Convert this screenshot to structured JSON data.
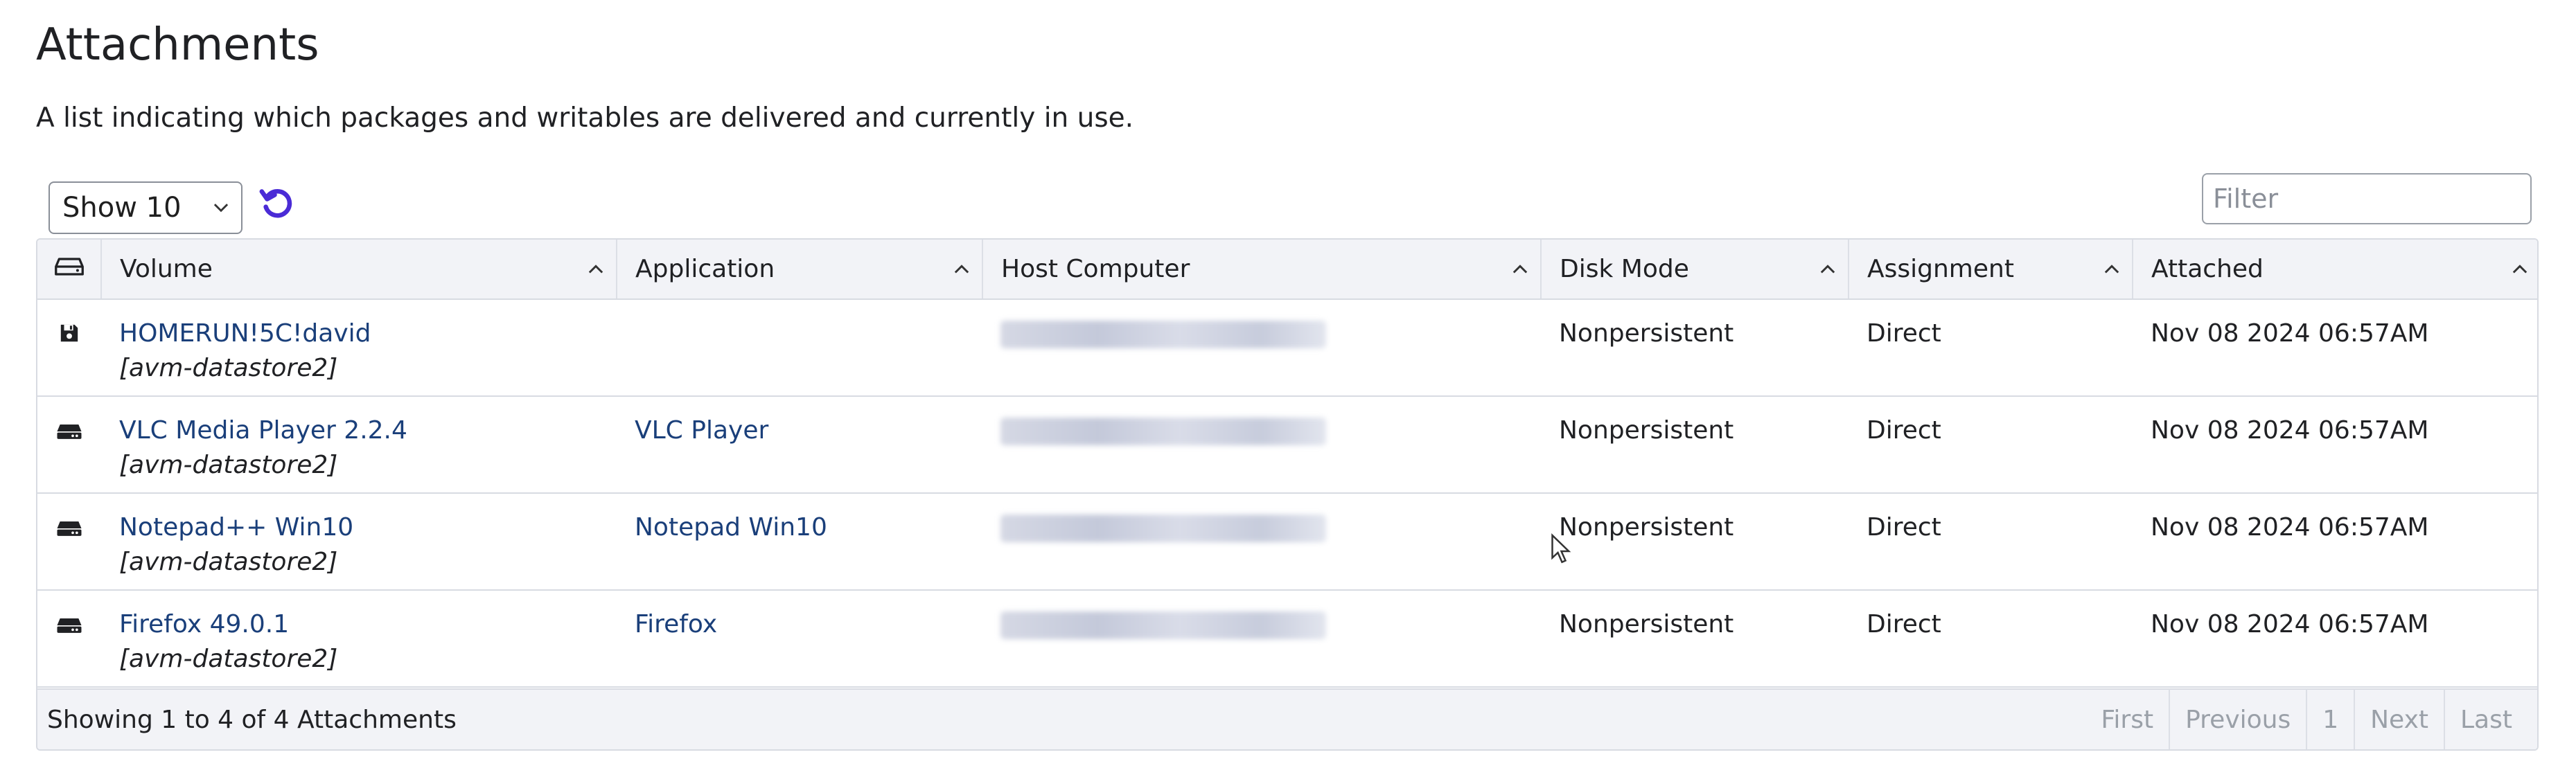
{
  "page": {
    "title": "Attachments",
    "description": "A list indicating which packages and writables are delivered and currently in use."
  },
  "toolbar": {
    "page_size": "Show 10",
    "filter_placeholder": "Filter"
  },
  "table": {
    "columns": [
      "Volume",
      "Application",
      "Host Computer",
      "Disk Mode",
      "Assignment",
      "Attached"
    ],
    "rows": [
      {
        "icon": "floppy-disk-icon",
        "volume": "HOMERUN!5C!david",
        "datastore": "[avm-datastore2]",
        "application": "",
        "host": "",
        "disk_mode": "Nonpersistent",
        "assignment": "Direct",
        "attached": "Nov 08 2024 06:57AM"
      },
      {
        "icon": "package-drive-icon",
        "volume": "VLC Media Player 2.2.4",
        "datastore": "[avm-datastore2]",
        "application": "VLC Player",
        "host": "",
        "disk_mode": "Nonpersistent",
        "assignment": "Direct",
        "attached": "Nov 08 2024 06:57AM"
      },
      {
        "icon": "package-drive-icon",
        "volume": "Notepad++ Win10",
        "datastore": "[avm-datastore2]",
        "application": "Notepad Win10",
        "host": "",
        "disk_mode": "Nonpersistent",
        "assignment": "Direct",
        "attached": "Nov 08 2024 06:57AM"
      },
      {
        "icon": "package-drive-icon",
        "volume": "Firefox 49.0.1",
        "datastore": "[avm-datastore2]",
        "application": "Firefox",
        "host": "",
        "disk_mode": "Nonpersistent",
        "assignment": "Direct",
        "attached": "Nov 08 2024 06:57AM"
      }
    ]
  },
  "footer": {
    "info": "Showing 1 to 4 of 4 Attachments",
    "pager": {
      "first": "First",
      "previous": "Previous",
      "current": "1",
      "next": "Next",
      "last": "Last"
    }
  },
  "colors": {
    "link": "#1a3f7a",
    "accent": "#4a2bd6",
    "header_bg": "#f2f3f7"
  }
}
